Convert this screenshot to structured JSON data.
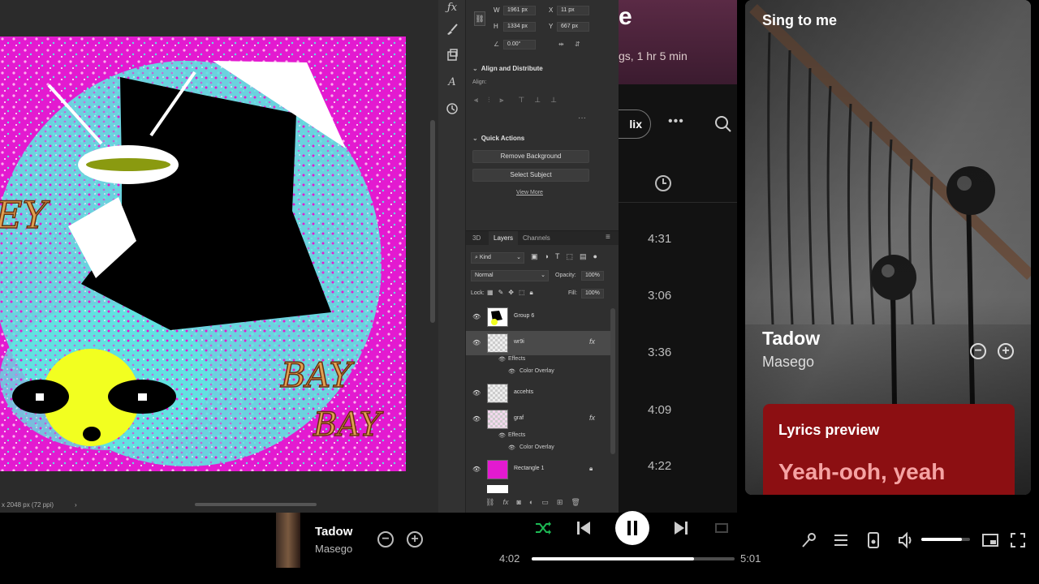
{
  "photoshop": {
    "status_text": "x 2048 px (72 ppi)",
    "properties": {
      "w": "1961 px",
      "h": "1334 px",
      "x": "11 px",
      "y": "667 px",
      "angle": "0.00°"
    },
    "align_section": {
      "title": "Align and Distribute",
      "align_label": "Align:"
    },
    "quick_actions": {
      "title": "Quick Actions",
      "remove_background": "Remove Background",
      "select_subject": "Select Subject",
      "view_more": "View More"
    },
    "tabs": [
      "3D",
      "Layers",
      "Channels"
    ],
    "active_tab": "Layers",
    "filter_kind": "Kind",
    "blend_mode": "Normal",
    "opacity_label": "Opacity:",
    "opacity_value": "100%",
    "lock_label": "Lock:",
    "fill_label": "Fill:",
    "fill_value": "100%",
    "layers": [
      {
        "name": "Group 6",
        "fx": false
      },
      {
        "name": "wr9i",
        "fx": true
      },
      {
        "name": "accehts",
        "fx": false
      },
      {
        "name": "graf",
        "fx": true
      },
      {
        "name": "Rectangle 1",
        "fx": false,
        "locked": true
      }
    ],
    "effects_label": "Effects",
    "color_overlay_label": "Color Overlay",
    "fx_label": "fx",
    "artwork_text": [
      "EY",
      "BAY",
      "BAY"
    ],
    "colors": {
      "magenta": "#e010d0",
      "cyan": "#5ee6e0",
      "yellow": "#f2ff20"
    }
  },
  "spotify": {
    "playlist_title_fragment": "e",
    "playlist_meta_fragment": "gs, 1 hr 5 min",
    "mix_fragment": "lix",
    "durations": [
      "4:31",
      "3:06",
      "3:36",
      "4:09",
      "4:22"
    ],
    "now_playing_panel": {
      "header": "Sing to me",
      "track": "Tadow",
      "artist": "Masego",
      "lyrics_title": "Lyrics preview",
      "lyrics_line": "Yeah-ooh, yeah"
    },
    "player": {
      "track": "Tadow",
      "artist": "Masego",
      "elapsed": "4:02",
      "total": "5:01",
      "progress_fraction": 0.8,
      "volume_fraction": 0.83
    },
    "colors": {
      "accent": "#1db954",
      "lyrics_card": "#8c0f12"
    }
  }
}
